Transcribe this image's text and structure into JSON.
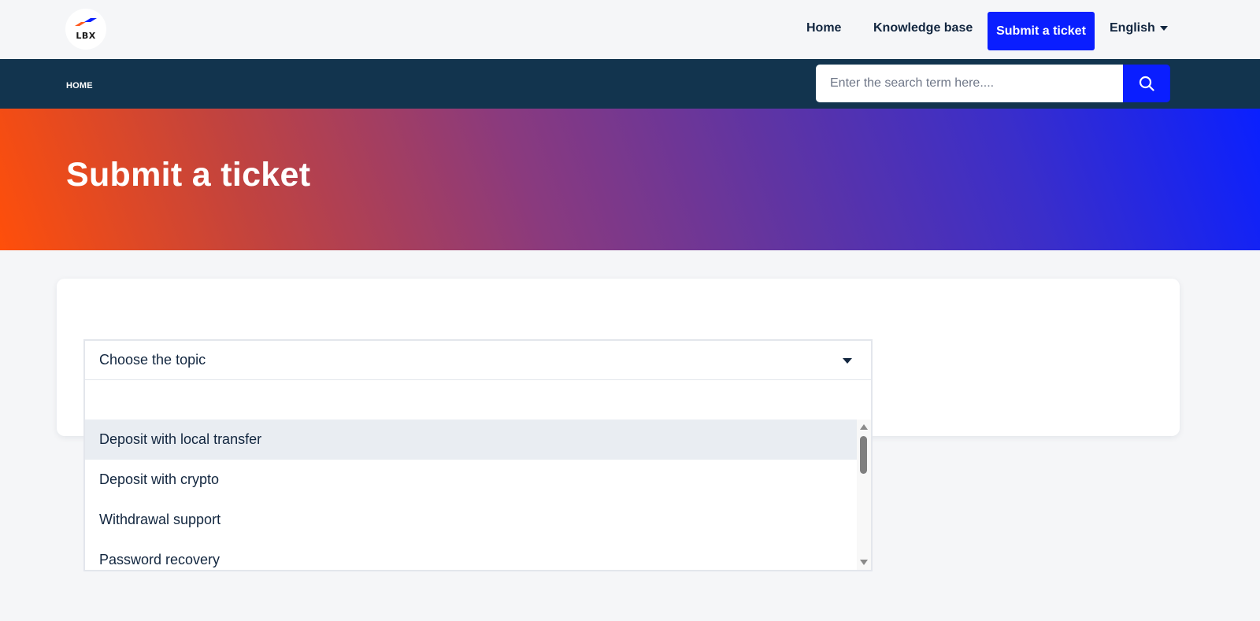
{
  "header": {
    "logo_text": "LBX",
    "nav": {
      "home": "Home",
      "knowledge_base": "Knowledge base",
      "submit_ticket": "Submit a ticket",
      "language": "English"
    }
  },
  "subbar": {
    "breadcrumb": "HOME",
    "search": {
      "placeholder": "Enter the search term here...."
    }
  },
  "hero": {
    "title": "Submit a ticket"
  },
  "form": {
    "topic_select": {
      "selected": "Choose the topic",
      "options": [
        "Deposit with local transfer",
        "Deposit with crypto",
        "Withdrawal support",
        "Password recovery"
      ]
    }
  },
  "colors": {
    "accent": "#0a1eff",
    "subbar": "#12344e",
    "text": "#12263f",
    "hero_start": "#ff4f0a",
    "hero_end": "#0a20ff"
  }
}
